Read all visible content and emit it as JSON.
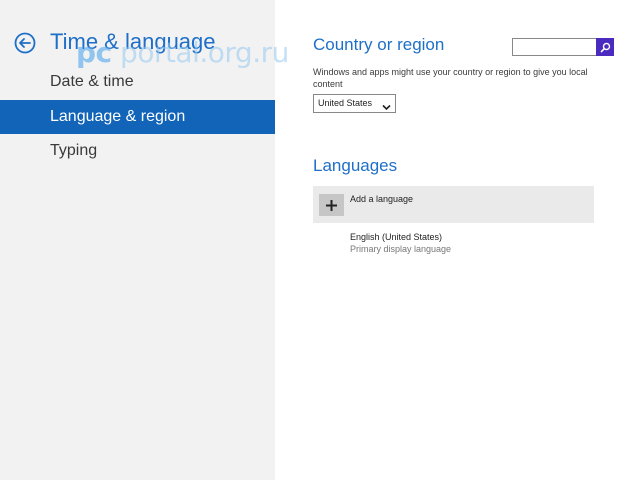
{
  "sidebar": {
    "title": "Time & language",
    "items": [
      {
        "label": "Date & time",
        "selected": false
      },
      {
        "label": "Language & region",
        "selected": true
      },
      {
        "label": "Typing",
        "selected": false
      }
    ]
  },
  "watermark": {
    "prefix": "pc",
    "rest": " portal.org.ru"
  },
  "country_section": {
    "title": "Country or region",
    "description": "Windows and apps might use your country or region to give you local content",
    "selected_country": "United States"
  },
  "search": {
    "value": "",
    "icon": "search-icon"
  },
  "languages_section": {
    "title": "Languages",
    "add_label": "Add a language",
    "entries": [
      {
        "name": "English (United States)",
        "status": "Primary display language"
      }
    ]
  },
  "colors": {
    "accent": "#1e6fc7",
    "selected_nav": "#1164b8",
    "search_button": "#4b2bbf",
    "sidebar_bg": "#f2f2f2"
  }
}
